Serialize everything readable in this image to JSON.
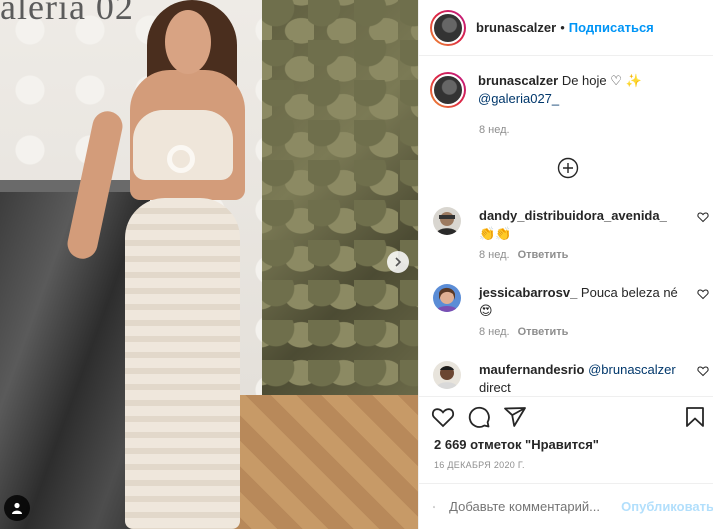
{
  "photo": {
    "background_logo_text": "aleria 02",
    "next_icon": "chevron-right-icon",
    "user_tag_icon": "person-icon"
  },
  "header": {
    "username": "bruna­scalzer",
    "separator": "•",
    "follow_label": "Подписаться"
  },
  "caption": {
    "username": "brunascalzer",
    "text": "De hoje ♡ ✨",
    "mention": "@galeria027_",
    "time": "8 нед."
  },
  "load_more_icon": "plus-circle-icon",
  "comments": [
    {
      "username": "dandy_distribuidora_avenida_",
      "text": "👏👏",
      "time": "8 нед.",
      "reply": "Ответить"
    },
    {
      "username": "jessicabarrosv_",
      "text": "Pouca beleza né 😍",
      "time": "8 нед.",
      "reply": "Ответить"
    },
    {
      "username": "maufernandesrio",
      "mention": "@brunascalzer",
      "text": "direct"
    }
  ],
  "actions": {
    "like_icon": "heart-icon",
    "comment_icon": "comment-icon",
    "share_icon": "paper-plane-icon",
    "save_icon": "bookmark-icon"
  },
  "likes": "2 669 отметок \"Нравится\"",
  "date": "16 ДЕКАБРЯ 2020 Г.",
  "add_comment": {
    "placeholder": "Добавьте комментарий...",
    "post_label": "Опубликовать"
  },
  "colors": {
    "accent": "#0095f6",
    "post_disabled": "#b2dffc",
    "muted": "#8e8e8e",
    "text": "#262626"
  }
}
